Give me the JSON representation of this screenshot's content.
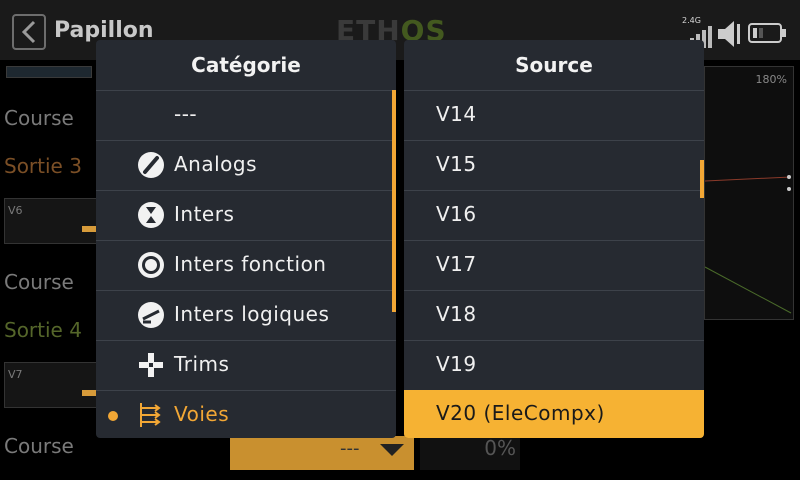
{
  "header": {
    "model_name": "Papillon",
    "logo_main": "ETH",
    "logo_os": "OS",
    "rf_band": "2.4G"
  },
  "background": {
    "labels": [
      "Course",
      "Sortie 3",
      "V6",
      "Course",
      "Sortie 4",
      "V7",
      "Course"
    ],
    "graph_percent": "180%",
    "dropdown_value": "---",
    "percent_value": "0%"
  },
  "category_panel": {
    "title": "Catégorie",
    "items": [
      {
        "label": "---",
        "icon": "none"
      },
      {
        "label": "Analogs",
        "icon": "analog-icon"
      },
      {
        "label": "Inters",
        "icon": "switch-icon"
      },
      {
        "label": "Inters fonction",
        "icon": "function-switch-icon"
      },
      {
        "label": "Inters logiques",
        "icon": "logic-switch-icon"
      },
      {
        "label": "Trims",
        "icon": "trim-icon"
      },
      {
        "label": "Voies",
        "icon": "channels-icon"
      }
    ],
    "selected_index": 6
  },
  "source_panel": {
    "title": "Source",
    "items": [
      "V14",
      "V15",
      "V16",
      "V17",
      "V18",
      "V19",
      "V20 (EleCompx)"
    ],
    "selected_index": 6
  },
  "colors": {
    "accent": "#f6b233",
    "panel_bg": "#262a31",
    "sortie3": "#8a5a2a",
    "sortie4": "#55662a"
  }
}
